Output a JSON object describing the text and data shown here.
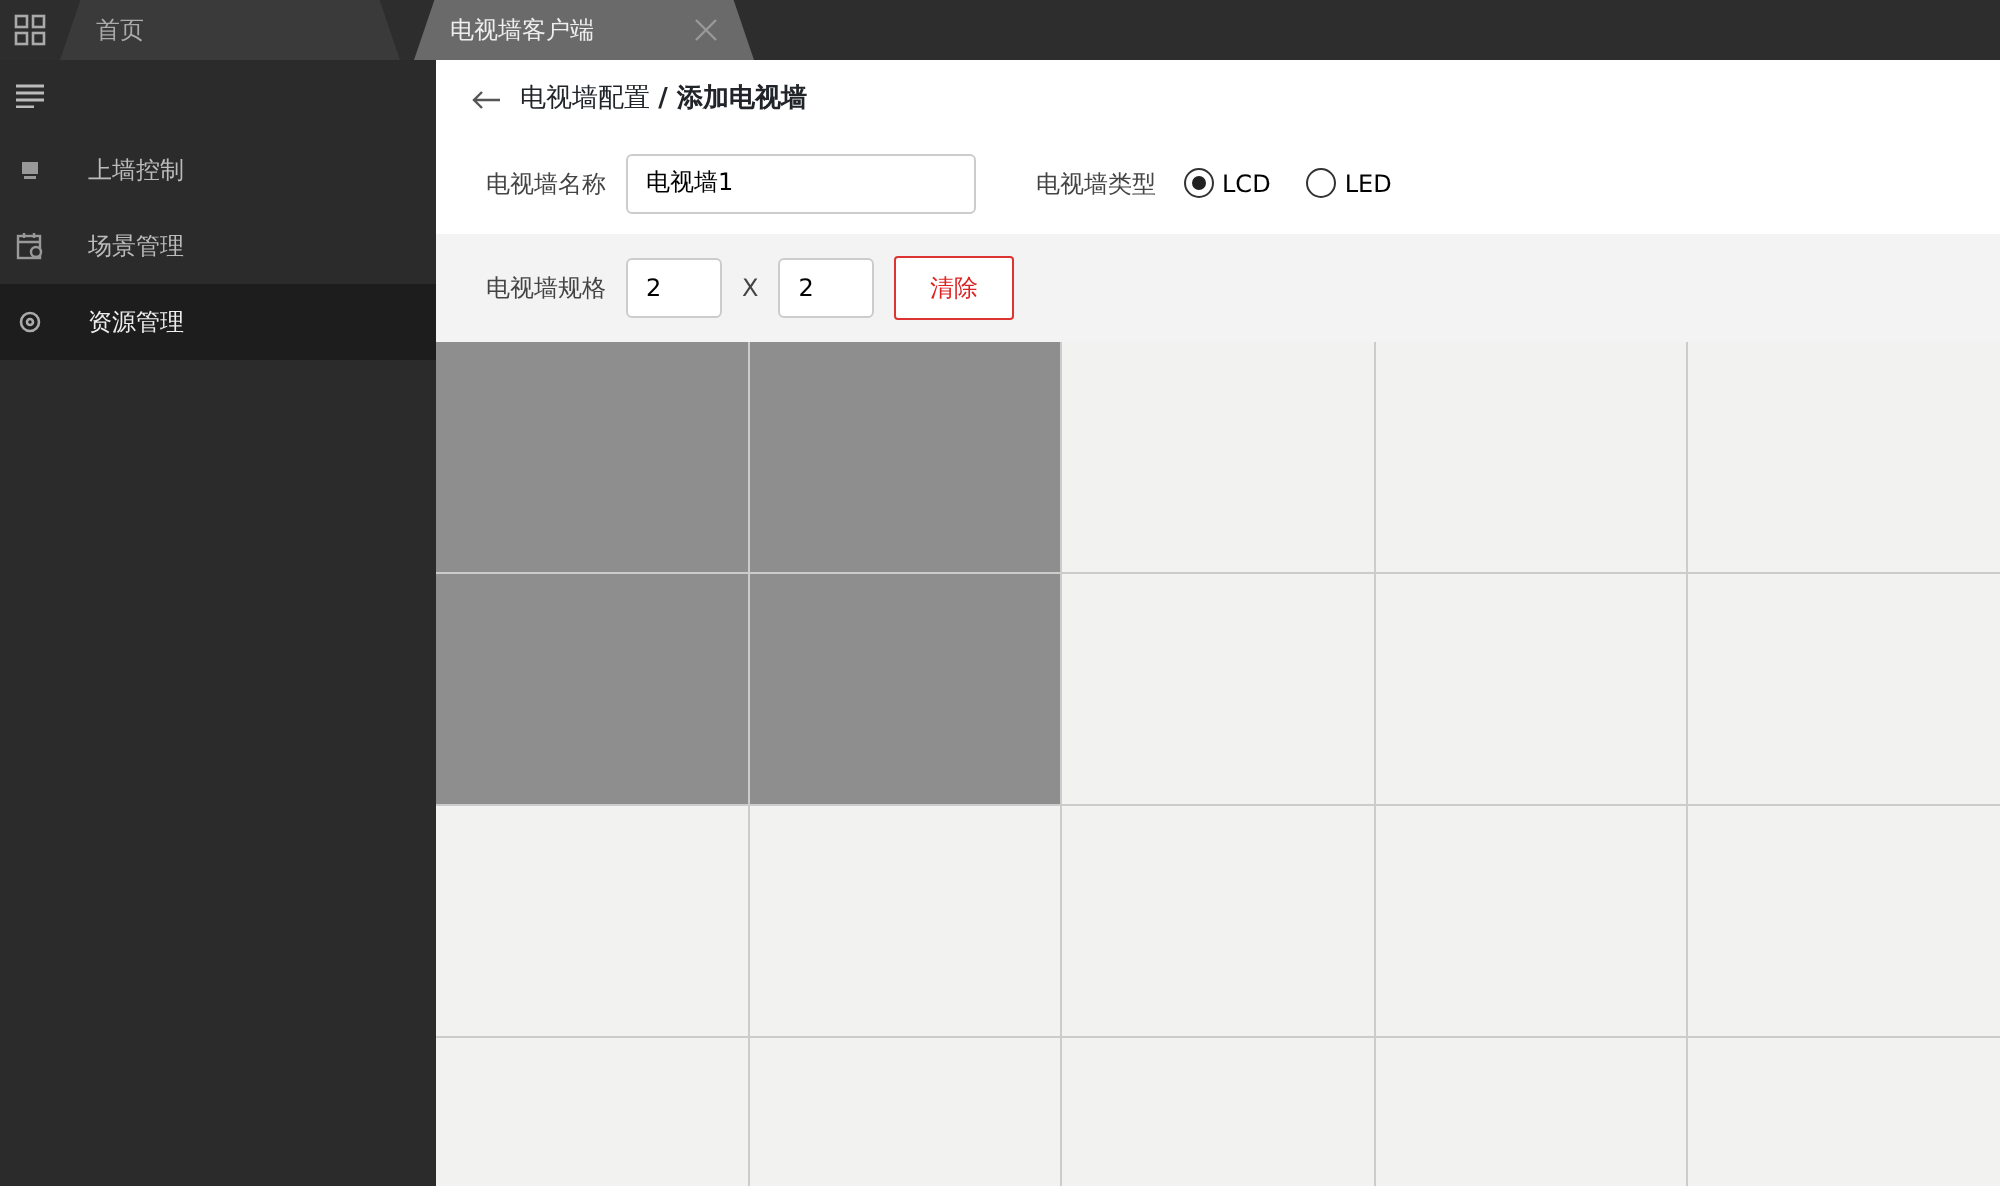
{
  "tabs": [
    {
      "label": "首页",
      "selected": false,
      "closable": false
    },
    {
      "label": "电视墙客户端",
      "selected": true,
      "closable": true
    }
  ],
  "sidebar": {
    "items": [
      {
        "label": "上墙控制",
        "kind": "monitor",
        "selected": false
      },
      {
        "label": "场景管理",
        "kind": "calendar",
        "selected": false
      },
      {
        "label": "资源管理",
        "kind": "gear",
        "selected": true
      }
    ]
  },
  "breadcrumb": {
    "parent": "电视墙配置",
    "separator": "/",
    "current": "添加电视墙"
  },
  "name_field": {
    "label": "电视墙名称",
    "value": "电视墙1"
  },
  "type_field": {
    "label": "电视墙类型",
    "options": [
      {
        "label": "LCD",
        "selected": true
      },
      {
        "label": "LED",
        "selected": false
      }
    ]
  },
  "spec_field": {
    "label": "电视墙规格",
    "rows_value": "2",
    "times": "X",
    "cols_value": "2",
    "clear_button": "清除"
  },
  "wall_grid": [
    [
      {
        "selected": true
      },
      {
        "selected": true
      },
      {
        "selected": false
      },
      {
        "selected": false
      },
      {
        "selected": false
      }
    ],
    [
      {
        "selected": true
      },
      {
        "selected": true
      },
      {
        "selected": false
      },
      {
        "selected": false
      },
      {
        "selected": false
      }
    ],
    [
      {
        "selected": false
      },
      {
        "selected": false
      },
      {
        "selected": false
      },
      {
        "selected": false
      },
      {
        "selected": false
      }
    ],
    [
      {
        "selected": false
      },
      {
        "selected": false
      },
      {
        "selected": false
      },
      {
        "selected": false
      },
      {
        "selected": false
      }
    ]
  ]
}
